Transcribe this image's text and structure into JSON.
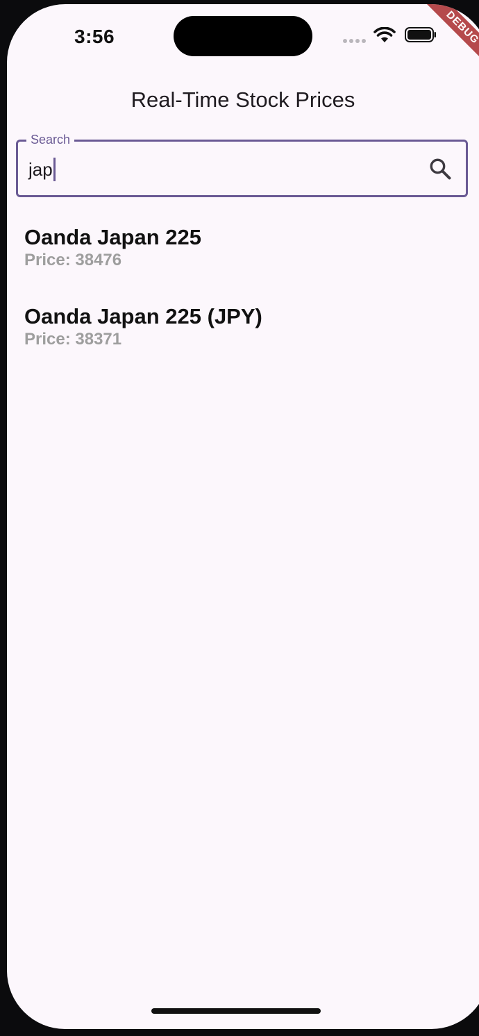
{
  "status_bar": {
    "time": "3:56",
    "debug_banner": "DEBUG"
  },
  "app_bar": {
    "title": "Real-Time Stock Prices"
  },
  "search": {
    "label": "Search",
    "value": "jap"
  },
  "stocks": [
    {
      "name": "Oanda Japan 225",
      "price": "Price: 38476"
    },
    {
      "name": "Oanda Japan 225 (JPY)",
      "price": "Price: 38371"
    }
  ],
  "colors": {
    "background": "#fcf7fc",
    "accent": "#6a5a94",
    "price_text": "#9e9e9e",
    "debug_banner": "#b54a4c"
  }
}
